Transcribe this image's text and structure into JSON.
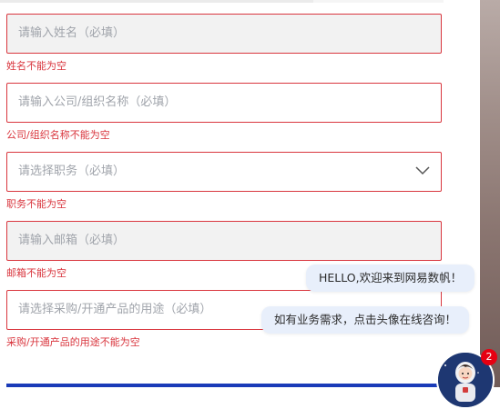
{
  "form": {
    "name": {
      "placeholder": "请输入姓名（必填）",
      "error": "姓名不能为空"
    },
    "company": {
      "placeholder": "请输入公司/组织名称（必填）",
      "error": "公司/组织名称不能为空"
    },
    "position": {
      "placeholder": "请选择职务（必填）",
      "error": "职务不能为空"
    },
    "email": {
      "placeholder": "请输入邮箱（必填）",
      "error": "邮箱不能为空"
    },
    "purpose": {
      "placeholder": "请选择采购/开通产品的用途（必填）",
      "error": "采购/开通产品的用途不能为空"
    }
  },
  "chat": {
    "greeting": "HELLO,欢迎来到网易数帆！",
    "prompt": "如有业务需求，点击头像在线咨询！",
    "badge_count": "2"
  },
  "colors": {
    "error": "#d9363e",
    "accent": "#1a3bb8",
    "bubble": "#e8effb"
  },
  "icons": {
    "dropdown": "chevron-down-icon",
    "avatar": "astronaut-avatar"
  }
}
